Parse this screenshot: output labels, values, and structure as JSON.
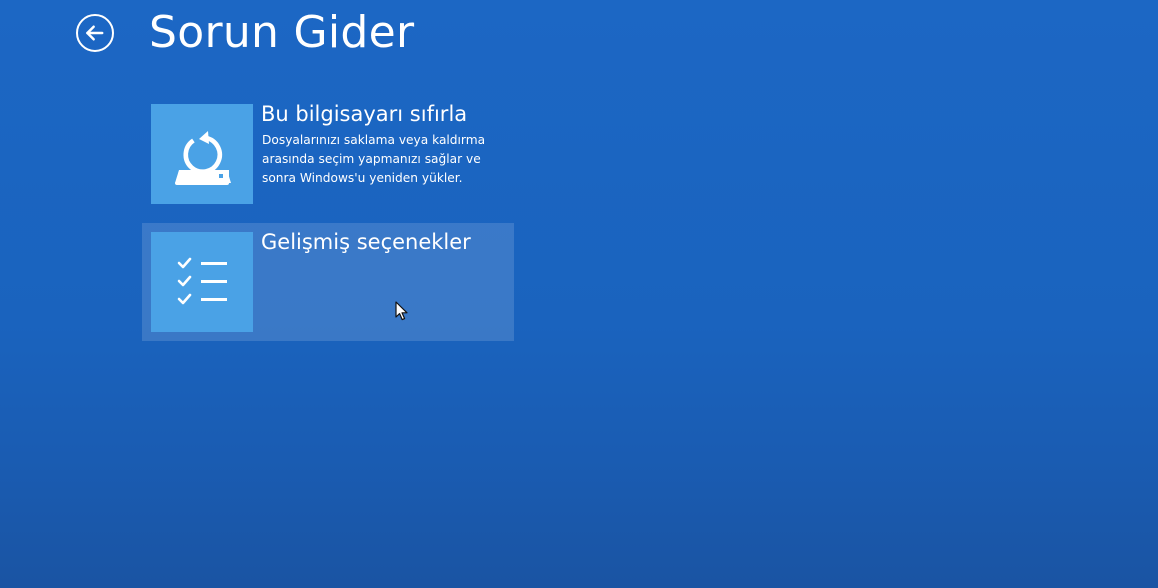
{
  "header": {
    "back_icon": "arrow-left-circle-icon",
    "title": "Sorun Gider"
  },
  "options": [
    {
      "icon": "pc-reset-icon",
      "title": "Bu bilgisayarı sıfırla",
      "description": "Dosyalarınızı saklama veya kaldırma arasında seçim yapmanızı sağlar ve sonra Windows'u yeniden yükler."
    },
    {
      "icon": "checklist-icon",
      "title": "Gelişmiş seçenekler",
      "description": ""
    }
  ],
  "colors": {
    "background": "#1c67c4",
    "tile": "#4aa2e6",
    "text": "#ffffff",
    "hover_highlight": "rgba(255,255,255,0.14)"
  },
  "pointer": "arrow-cursor-icon"
}
